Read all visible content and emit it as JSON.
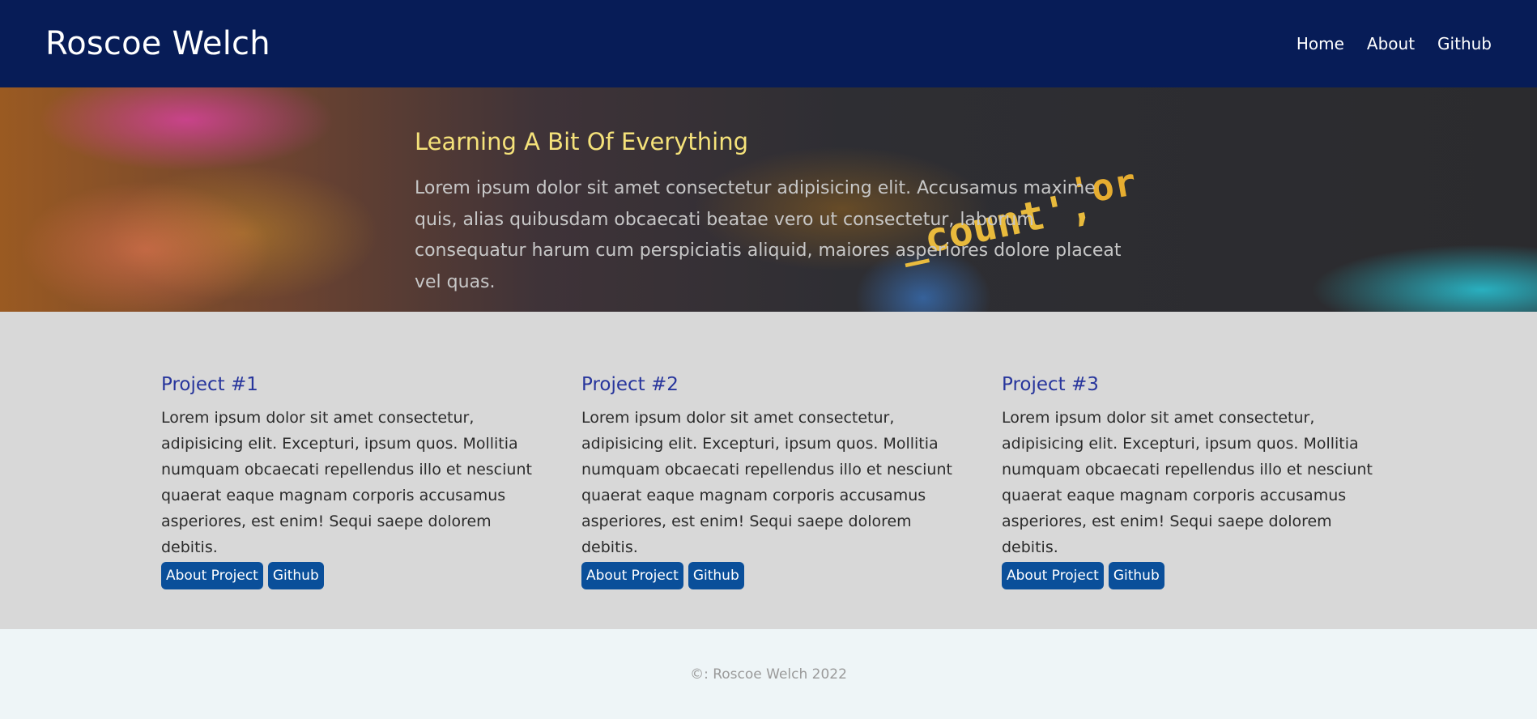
{
  "header": {
    "brand": "Roscoe Welch",
    "nav": [
      "Home",
      "About",
      "Github"
    ]
  },
  "hero": {
    "title": "Learning A Bit Of Everything",
    "text": "Lorem ipsum dolor sit amet consectetur adipisicing elit. Accusamus maxime quis, alias quibusdam obcaecati beatae vero ut consectetur, laborum consequatur harum cum perspiciatis aliquid, maiores asperiores dolore placeat vel quas."
  },
  "projects": [
    {
      "title": "Project #1",
      "text": "Lorem ipsum dolor sit amet consectetur, adipisicing elit. Excepturi, ipsum quos. Mollitia numquam obcaecati repellendus illo et nesciunt quaerat eaque magnam corporis accusamus asperiores, est enim! Sequi saepe dolorem debitis.",
      "about_label": "About Project",
      "github_label": "Github"
    },
    {
      "title": "Project #2",
      "text": "Lorem ipsum dolor sit amet consectetur, adipisicing elit. Excepturi, ipsum quos. Mollitia numquam obcaecati repellendus illo et nesciunt quaerat eaque magnam corporis accusamus asperiores, est enim! Sequi saepe dolorem debitis.",
      "about_label": "About Project",
      "github_label": "Github"
    },
    {
      "title": "Project #3",
      "text": "Lorem ipsum dolor sit amet consectetur, adipisicing elit. Excepturi, ipsum quos. Mollitia numquam obcaecati repellendus illo et nesciunt quaerat eaque magnam corporis accusamus asperiores, est enim! Sequi saepe dolorem debitis.",
      "about_label": "About Project",
      "github_label": "Github"
    }
  ],
  "footer": {
    "text": "©: Roscoe Welch 2022"
  },
  "colors": {
    "header_bg": "#071c57",
    "hero_title": "#f5e27a",
    "project_title": "#27359c",
    "button_bg": "#0a4f9a",
    "projects_bg": "#d8d8d8",
    "footer_bg": "#eef5f7"
  }
}
